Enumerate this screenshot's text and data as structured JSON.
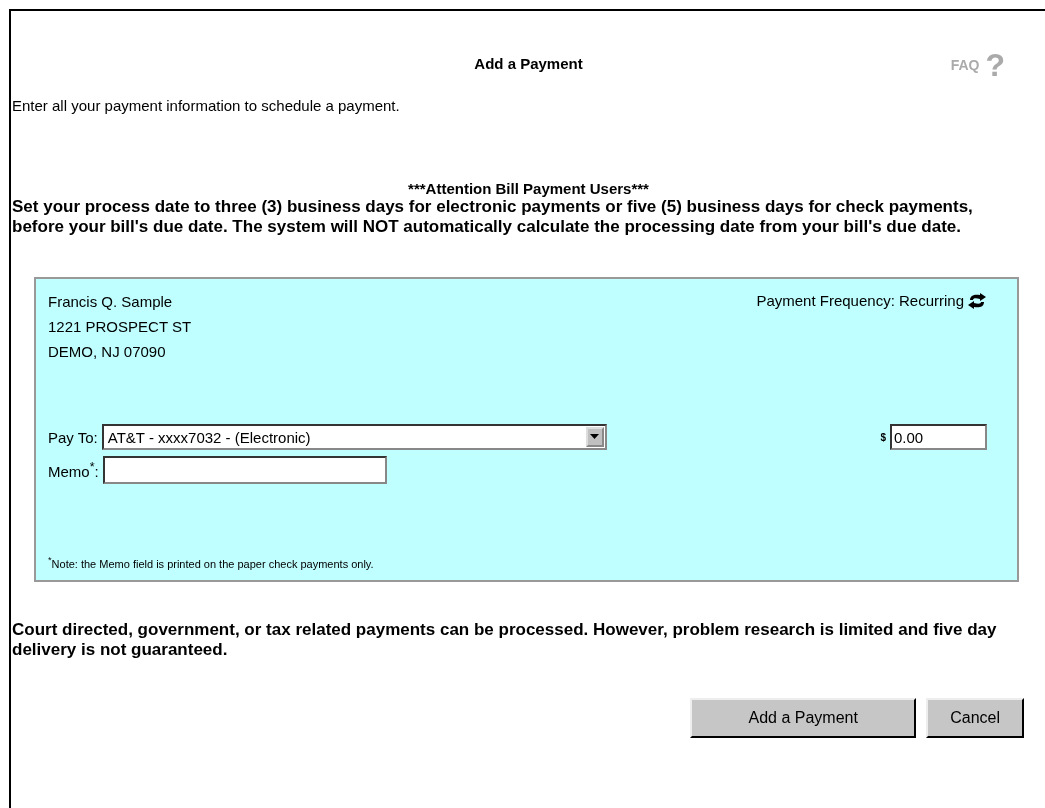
{
  "title": "Add a Payment",
  "faq": {
    "label": "FAQ",
    "icon": "?"
  },
  "intro": "Enter all your payment information to schedule a payment.",
  "attention": {
    "heading": "***Attention Bill Payment Users***",
    "text": "Set your process date to three (3) business days for electronic payments or five (5) business days for check payments, before your bill's due date. The system will NOT automatically calculate the processing date from your bill's due date."
  },
  "payment": {
    "address": [
      "Francis Q. Sample",
      "1221 PROSPECT ST",
      "DEMO, NJ 07090"
    ],
    "frequency": "Payment Frequency: Recurring",
    "pay_to": {
      "label": "Pay To:",
      "value": "AT&T - xxxx7032 - (Electronic)"
    },
    "amount": {
      "currency": "$",
      "value": "0.00"
    },
    "memo": {
      "label": "Memo$^{*}$:"
    },
    "note": "$^{*}$Note: the Memo field is printed on the paper check payments only."
  },
  "disclaimer": "Court directed, government, or tax related payments can be processed. However, problem research is limited and five day delivery is not guaranteed.",
  "buttons": [
    "Add a Payment",
    "Cancel"
  ]
}
